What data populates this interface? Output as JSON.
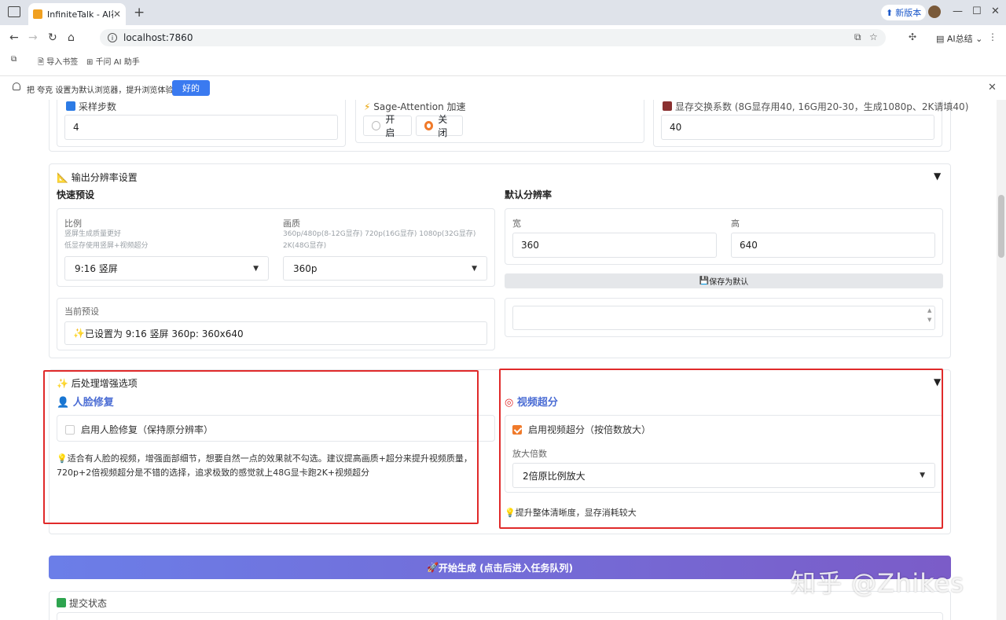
{
  "browser": {
    "tab_title": "InfiniteTalk - AI视",
    "tab_close": "✕",
    "new_tab": "+",
    "new_version": "新版本",
    "url": "localhost:7860",
    "ai_summary": "AI总结",
    "bookmarks": [
      "导入书签",
      "千问 AI 助手"
    ],
    "infobar_msg": "把 夸克 设置为默认浏览器，提升浏览体验",
    "infobar_ok": "好的"
  },
  "top_row": {
    "steps_label": "采样步数",
    "steps_value": "4",
    "sage_label": "Sage-Attention 加速",
    "sage_on": "开启",
    "sage_off": "关闭",
    "vram_label": "显存交换系数 (8G显存用40, 16G用20-30，生成1080p、2K请填40)",
    "vram_value": "40"
  },
  "resolution": {
    "section_title": "输出分辨率设置",
    "collapse": "▼",
    "quick_preset": "快速预设",
    "ratio_label": "比例",
    "ratio_hint1": "竖屏生成质量更好",
    "ratio_hint2": "低显存使用竖屏+视频超分",
    "ratio_value": "9:16 竖屏",
    "quality_label": "画质",
    "quality_hint1": "360p/480p(8-12G显存) 720p(16G显存) 1080p(32G显存)",
    "quality_hint2": "2K(48G显存)",
    "quality_value": "360p",
    "current_label": "当前预设",
    "current_value": "已设置为 9:16 竖屏 360p: 360x640",
    "default_res": "默认分辨率",
    "width_label": "宽",
    "width_value": "360",
    "height_label": "高",
    "height_value": "640",
    "save_default": "保存为默认"
  },
  "postprocess": {
    "section_title": "后处理增强选项",
    "collapse": "▼",
    "face_title": "人脸修复",
    "face_checkbox": "启用人脸修复（保持原分辨率）",
    "face_tip1": "适合有人脸的视频，增强面部细节，想要自然一点的效果就不勾选。建议提高画质+超分来提升视频质量，",
    "face_tip2": "720p+2倍视频超分是不错的选择，追求极致的感觉就上48G显卡跑2K+视频超分",
    "sr_title": "视频超分",
    "sr_checkbox": "启用视频超分（按倍数放大）",
    "scale_label": "放大倍数",
    "scale_value": "2倍原比例放大",
    "sr_tip": "提升整体清晰度，显存消耗较大"
  },
  "generate_button": "开始生成 (点击后进入任务队列)",
  "submit_status": "提交状态",
  "watermark": "知乎 @Zhikes"
}
